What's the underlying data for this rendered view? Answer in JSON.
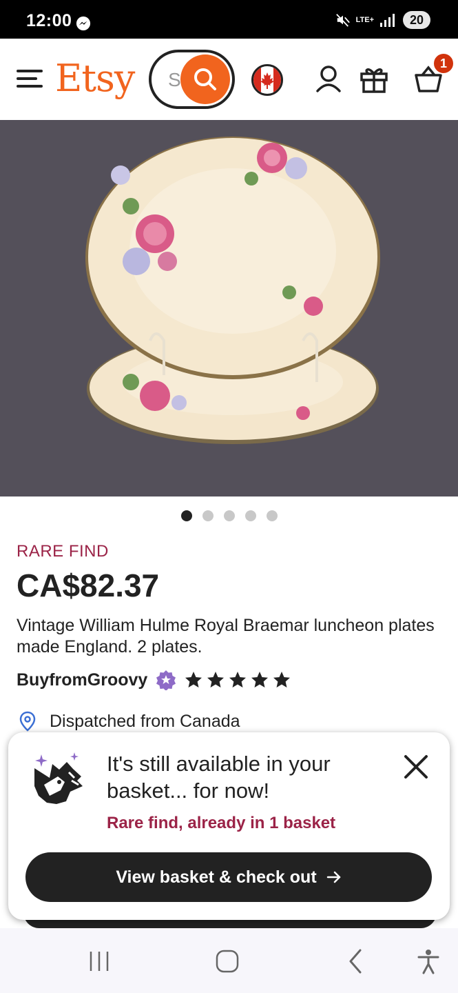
{
  "status_bar": {
    "time": "12:00",
    "battery": "20",
    "network": "LTE+"
  },
  "header": {
    "logo": "Etsy",
    "search_placeholder": "S",
    "cart_count": "1"
  },
  "gallery": {
    "image_count": 5,
    "active_index": 0
  },
  "listing": {
    "label": "RARE FIND",
    "price": "CA$82.37",
    "title": "Vintage William Hulme Royal Braemar luncheon plates made England. 2 plates.",
    "seller": "BuyfromGroovy",
    "rating": 5,
    "dispatch": "Dispatched from Canada"
  },
  "popup": {
    "headline": "It's still available in your basket... for now!",
    "subtext": "Rare find, already in 1 basket",
    "button_label": "View basket & check out"
  },
  "colors": {
    "brand": "#F1641E",
    "rare": "#9B2347",
    "badge": "#D1330C",
    "dark": "#222222"
  }
}
